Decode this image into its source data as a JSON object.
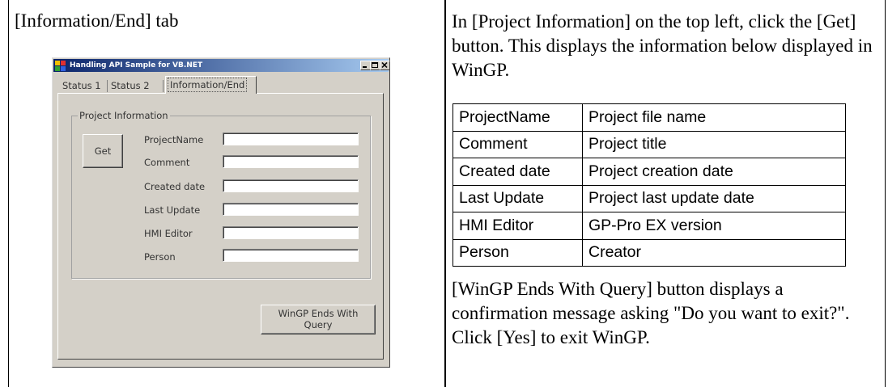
{
  "left_heading": "[Information/End] tab",
  "window": {
    "title": "Handling API Sample for VB.NET",
    "tabs": [
      "Status 1",
      "Status 2",
      "Information/End"
    ],
    "group_label": "Project Information",
    "get_button": "Get",
    "fields": [
      {
        "label": "ProjectName",
        "value": ""
      },
      {
        "label": "Comment",
        "value": ""
      },
      {
        "label": "Created date",
        "value": ""
      },
      {
        "label": "Last Update",
        "value": ""
      },
      {
        "label": "HMI Editor",
        "value": ""
      },
      {
        "label": "Person",
        "value": ""
      }
    ],
    "exit_button_line1": "WinGP Ends With",
    "exit_button_line2": "Query"
  },
  "right": {
    "intro": "In [Project Information] on the top left, click the [Get] button. This displays the information below displayed in WinGP.",
    "table": [
      {
        "item": "ProjectName",
        "description": "Project file name"
      },
      {
        "item": "Comment",
        "description": "Project title"
      },
      {
        "item": "Created date",
        "description": "Project creation date"
      },
      {
        "item": "Last Update",
        "description": "Project last update date"
      },
      {
        "item": "HMI Editor",
        "description": "GP-Pro EX version"
      },
      {
        "item": "Person",
        "description": "Creator"
      }
    ],
    "outro": "[WinGP Ends With Query] button displays a confirmation message asking \"Do you want to exit?\". Click [Yes] to exit WinGP."
  }
}
